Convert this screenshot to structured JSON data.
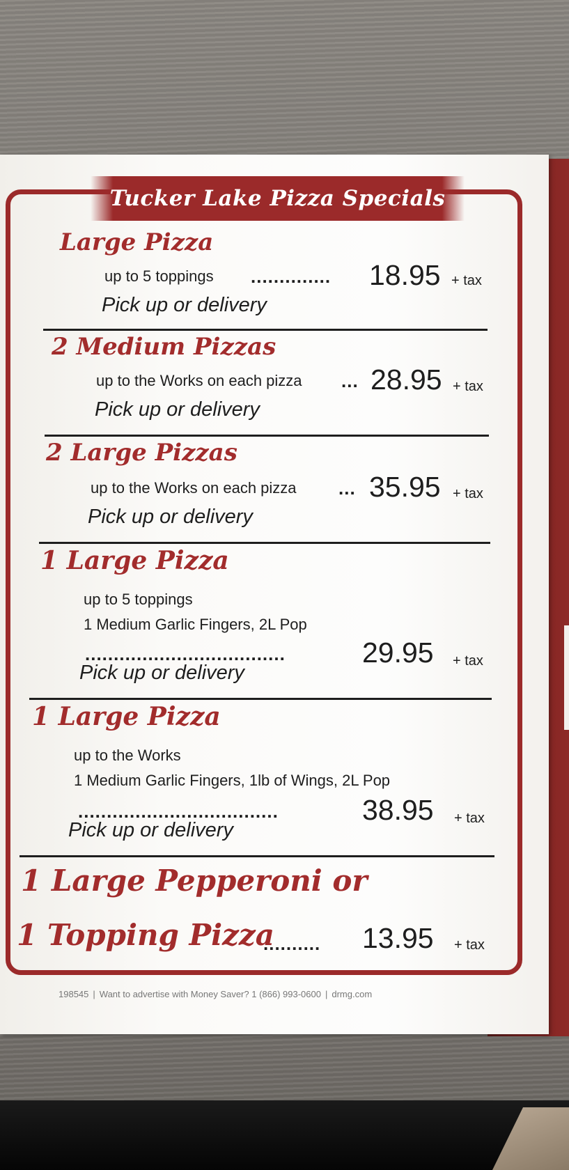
{
  "menu": {
    "title": "Tucker Lake Pizza Specials",
    "specials": [
      {
        "heading": "Large Pizza",
        "details": [
          "up to 5 toppings"
        ],
        "dots": "..............",
        "price": "18.95",
        "tax": "+ tax",
        "note": "Pick up or delivery"
      },
      {
        "heading": "2 Medium Pizzas",
        "details": [
          "up to the Works on each pizza"
        ],
        "dots": "...",
        "price": "28.95",
        "tax": "+ tax",
        "note": "Pick up or delivery"
      },
      {
        "heading": "2 Large Pizzas",
        "details": [
          "up to the Works on each pizza"
        ],
        "dots": "...",
        "price": "35.95",
        "tax": "+ tax",
        "note": "Pick up or delivery"
      },
      {
        "heading": "1 Large Pizza",
        "details": [
          "up to 5 toppings",
          "1 Medium Garlic Fingers, 2L Pop"
        ],
        "dots": "...................................",
        "price": "29.95",
        "tax": "+ tax",
        "note": "Pick up or delivery"
      },
      {
        "heading": "1 Large Pizza",
        "details": [
          "up to the Works",
          "1 Medium Garlic Fingers, 1lb of Wings, 2L Pop"
        ],
        "dots": "...................................",
        "price": "38.95",
        "tax": "+ tax",
        "note": "Pick up or delivery"
      },
      {
        "heading_line1": "1 Large Pepperoni or",
        "heading_line2": "1 Topping Pizza",
        "dots": "..........",
        "price": "13.95",
        "tax": "+ tax"
      }
    ],
    "footer": {
      "code": "198545",
      "advertise": "Want to advertise with Money Saver? 1 (866) 993-0600",
      "site": "drmg.com"
    }
  },
  "colors": {
    "accent_red": "#9b2a2a",
    "text_dark": "#1e1e1e",
    "paper": "#fdfdfc"
  }
}
